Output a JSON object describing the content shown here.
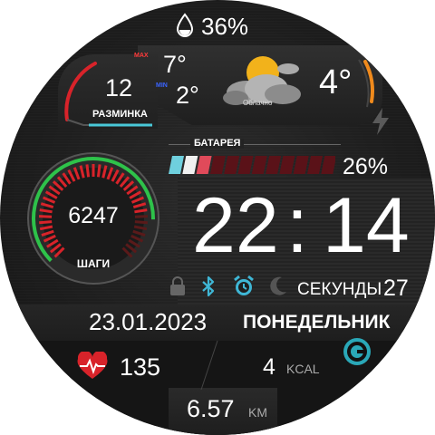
{
  "humidity": {
    "value": "36%",
    "icon": "water-drop-icon"
  },
  "warmup": {
    "value": "12",
    "label": "РАЗМИНКА"
  },
  "temperature": {
    "max_tag": "MAX",
    "max": "7°",
    "min_tag": "MIN",
    "min": "2°",
    "current": "4°",
    "condition": "Облачно",
    "icon": "partly-cloudy-icon"
  },
  "battery": {
    "label": "БАТАРЕЯ",
    "percent_text": "26%",
    "level": 0.26,
    "segments_total": 12,
    "segments_filled": 3,
    "icon": "lightning-icon"
  },
  "steps": {
    "value": "6247",
    "label": "ШАГИ",
    "progress": 0.62
  },
  "clock": {
    "hours": "22",
    "separator": ":",
    "minutes": "14",
    "seconds_label": "СЕКУНДЫ",
    "seconds": "27"
  },
  "status_icons": [
    "lock-icon",
    "bluetooth-icon",
    "alarm-icon",
    "moon-icon"
  ],
  "date": {
    "date": "23.01.2023",
    "weekday": "ПОНЕДЕЛЬНИК"
  },
  "heart_rate": {
    "value": "135",
    "icon": "heart-pulse-icon"
  },
  "calories": {
    "value": "4",
    "unit": "KCAL",
    "icon": "google-fit-icon"
  },
  "distance": {
    "value": "6.57",
    "unit": "KM"
  },
  "colors": {
    "accent_cyan": "#49c8d8",
    "accent_red": "#d8232a",
    "accent_green": "#2ec24a",
    "accent_orange": "#f08a1c"
  }
}
